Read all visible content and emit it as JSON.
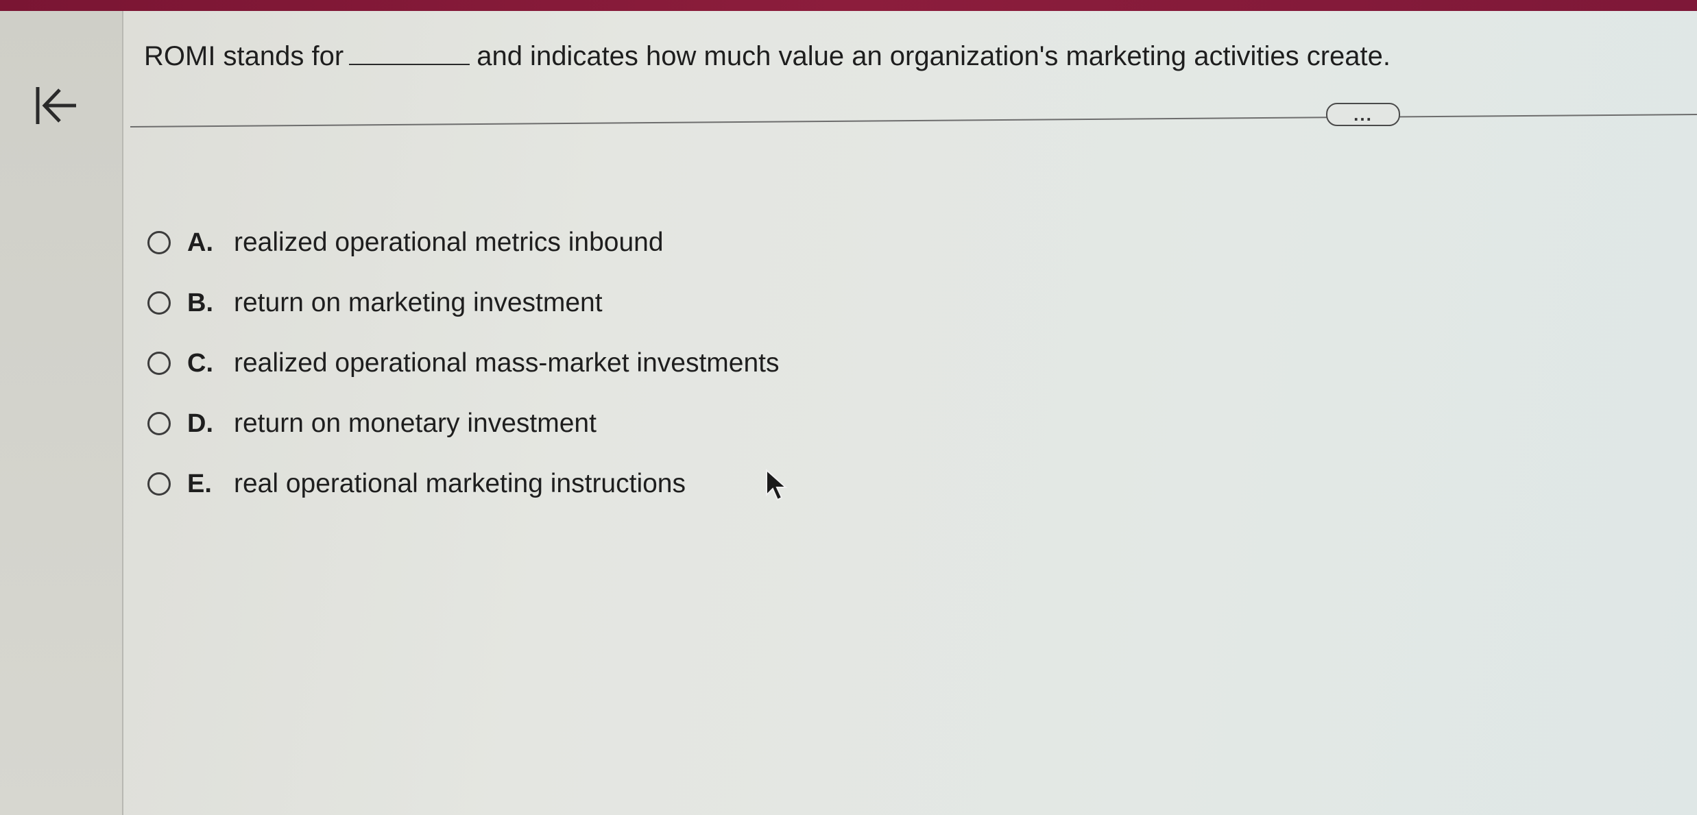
{
  "question": {
    "before_blank": "ROMI stands for",
    "after_blank": "and indicates how much value an organization's marketing activities create."
  },
  "more_button": "...",
  "options": [
    {
      "letter": "A.",
      "text": "realized operational metrics inbound"
    },
    {
      "letter": "B.",
      "text": "return on marketing investment"
    },
    {
      "letter": "C.",
      "text": "realized operational mass-market investments"
    },
    {
      "letter": "D.",
      "text": "return on monetary investment"
    },
    {
      "letter": "E.",
      "text": "real operational marketing instructions"
    }
  ],
  "icons": {
    "collapse": "collapse-left-arrow-icon",
    "cursor": "mouse-pointer-icon",
    "radio": "radio-unchecked-icon"
  },
  "colors": {
    "top_strip": "#8c1d3c",
    "text": "#1e1e1e"
  }
}
